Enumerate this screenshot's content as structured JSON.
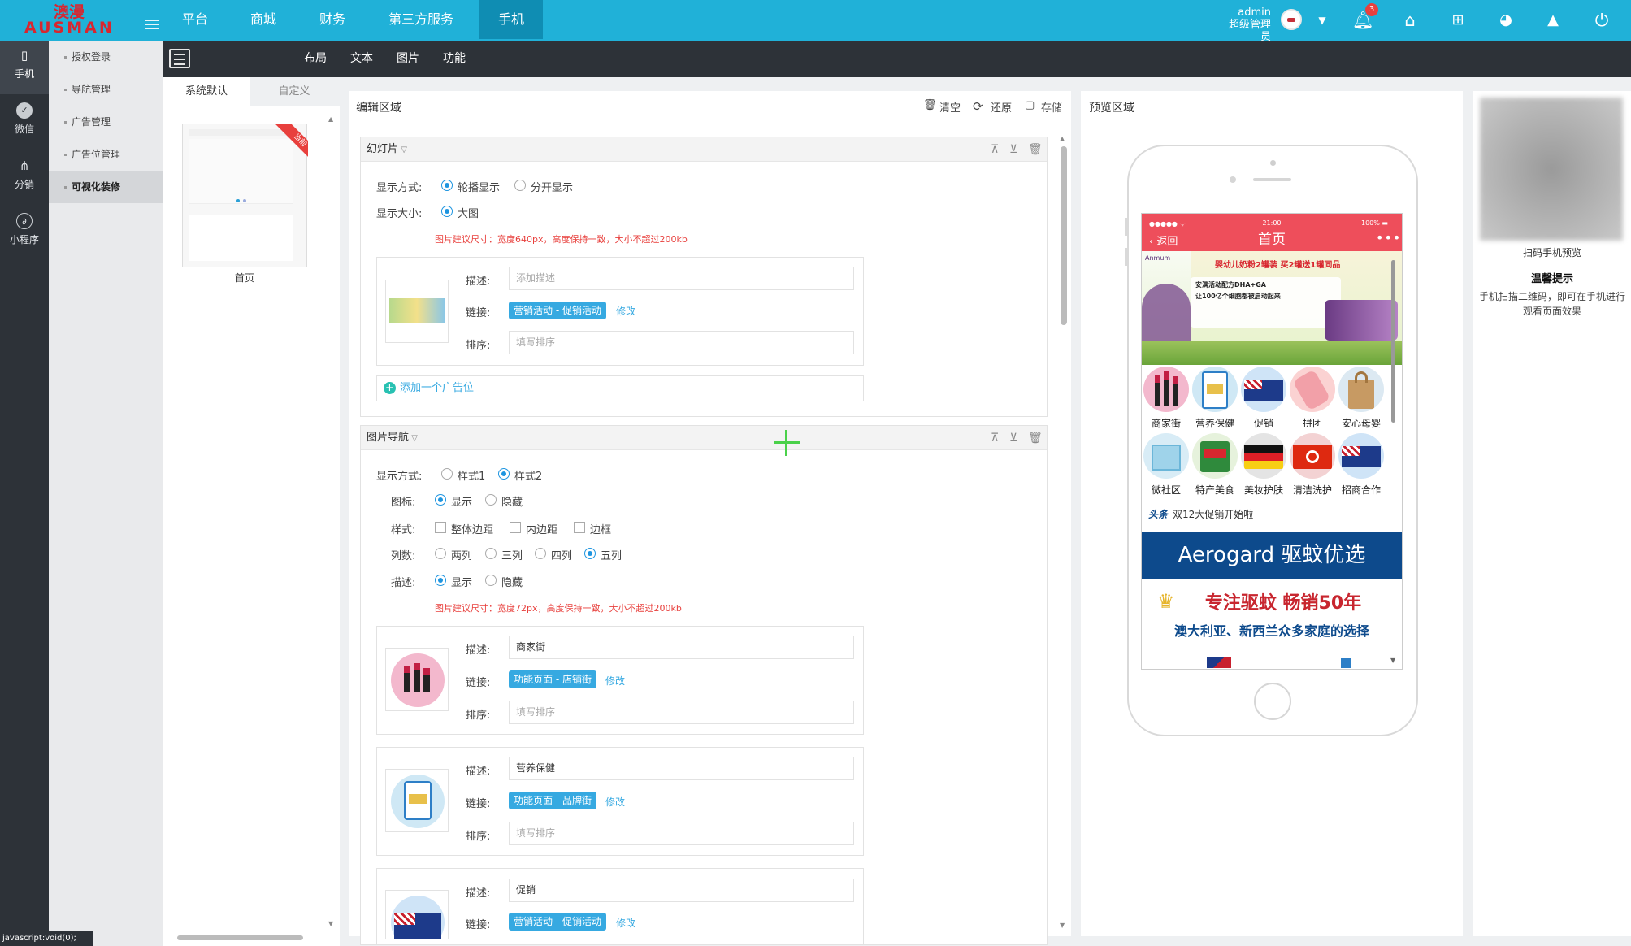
{
  "brand": {
    "name_cn": "澳漫",
    "name_en": "AUSMAN"
  },
  "topnav": [
    "平台",
    "商城",
    "财务",
    "第三方服务",
    "手机"
  ],
  "user": {
    "name": "admin",
    "role": "超级管理员",
    "notifications": "3"
  },
  "iconbar": [
    "手机",
    "微信",
    "分销",
    "小程序"
  ],
  "submenu": [
    "授权登录",
    "导航管理",
    "广告管理",
    "广告位管理",
    "可视化装修"
  ],
  "toolbar_tabs": [
    "布局",
    "文本",
    "图片",
    "功能"
  ],
  "templates": {
    "tabs": [
      "系统默认",
      "自定义"
    ],
    "card_name": "首页",
    "ribbon": "当前"
  },
  "edit": {
    "title": "编辑区域",
    "actions": [
      "清空",
      "还原",
      "存储"
    ],
    "slideshow": {
      "title": "幻灯片",
      "display_mode_label": "显示方式:",
      "display_modes": [
        "轮播显示",
        "分开显示"
      ],
      "size_label": "显示大小:",
      "size_value": "大图",
      "hint": "图片建议尺寸：宽度640px，高度保持一致，大小不超过200kb",
      "item": {
        "desc_label": "描述:",
        "desc_placeholder": "添加描述",
        "link_label": "链接:",
        "link_tag": "营销活动 - 促销活动",
        "modify": "修改",
        "sort_label": "排序:",
        "sort_placeholder": "填写排序"
      },
      "add_slot": "添加一个广告位"
    },
    "imgnav": {
      "title": "图片导航",
      "display_mode_label": "显示方式:",
      "styles": [
        "样式1",
        "样式2"
      ],
      "icon_label": "图标:",
      "style_label": "样式:",
      "style_options": [
        "整体边距",
        "内边距",
        "边框"
      ],
      "columns_label": "列数:",
      "columns": [
        "两列",
        "三列",
        "四列",
        "五列"
      ],
      "desc_label": "描述:",
      "show": "显示",
      "hide": "隐藏",
      "hint": "图片建议尺寸：宽度72px，高度保持一致，大小不超过200kb",
      "items": [
        {
          "desc": "商家街",
          "link_tag": "功能页面 - 店铺街",
          "sort_placeholder": "填写排序"
        },
        {
          "desc": "营养保健",
          "link_tag": "功能页面 - 品牌街",
          "sort_placeholder": "填写排序"
        },
        {
          "desc": "促销",
          "link_tag": "营销活动 - 促销活动",
          "sort_placeholder": "填写排序"
        }
      ],
      "row_desc_label": "描述:",
      "row_link_label": "链接:",
      "row_sort_label": "排序:",
      "modify": "修改"
    }
  },
  "preview": {
    "title": "预览区域",
    "status": {
      "signal": "●●●●● ᯤ",
      "time": "21:00",
      "battery": "100% ▬"
    },
    "page_title": "首页",
    "back": "返回",
    "more": "•••",
    "banner_logo": "Anmum",
    "banner_lines": [
      "婴幼儿奶粉2罐装 买2罐送1罐同品",
      "安满活动配方DHA+GA",
      "让100亿个细胞都被启动起来"
    ],
    "nav_row1": [
      "商家街",
      "营养保健",
      "促销",
      "拼团",
      "安心母婴"
    ],
    "nav_row2": [
      "微社区",
      "特产美食",
      "美妆护肤",
      "清洁洗护",
      "招商合作"
    ],
    "ticker_tag": "头条",
    "ticker": "双12大促销开始啦",
    "ad_banner": "Aerogard 驱蚊优选",
    "ad_slogan": "专注驱蚊  畅销50年",
    "ad_sub": "澳大利亚、新西兰众多家庭的选择"
  },
  "qr": {
    "caption": "扫码手机预览",
    "tip_title": "温馨提示",
    "tip": "手机扫描二维码，即可在手机进行观看页面效果"
  },
  "statusbar": "javascript:void(0);",
  "colors": {
    "topbar": "#20b1d8",
    "sidebar": "#2d3238",
    "accent": "#36a9e1",
    "hint": "#e8403d",
    "phone_bar": "#ee4e5b"
  }
}
